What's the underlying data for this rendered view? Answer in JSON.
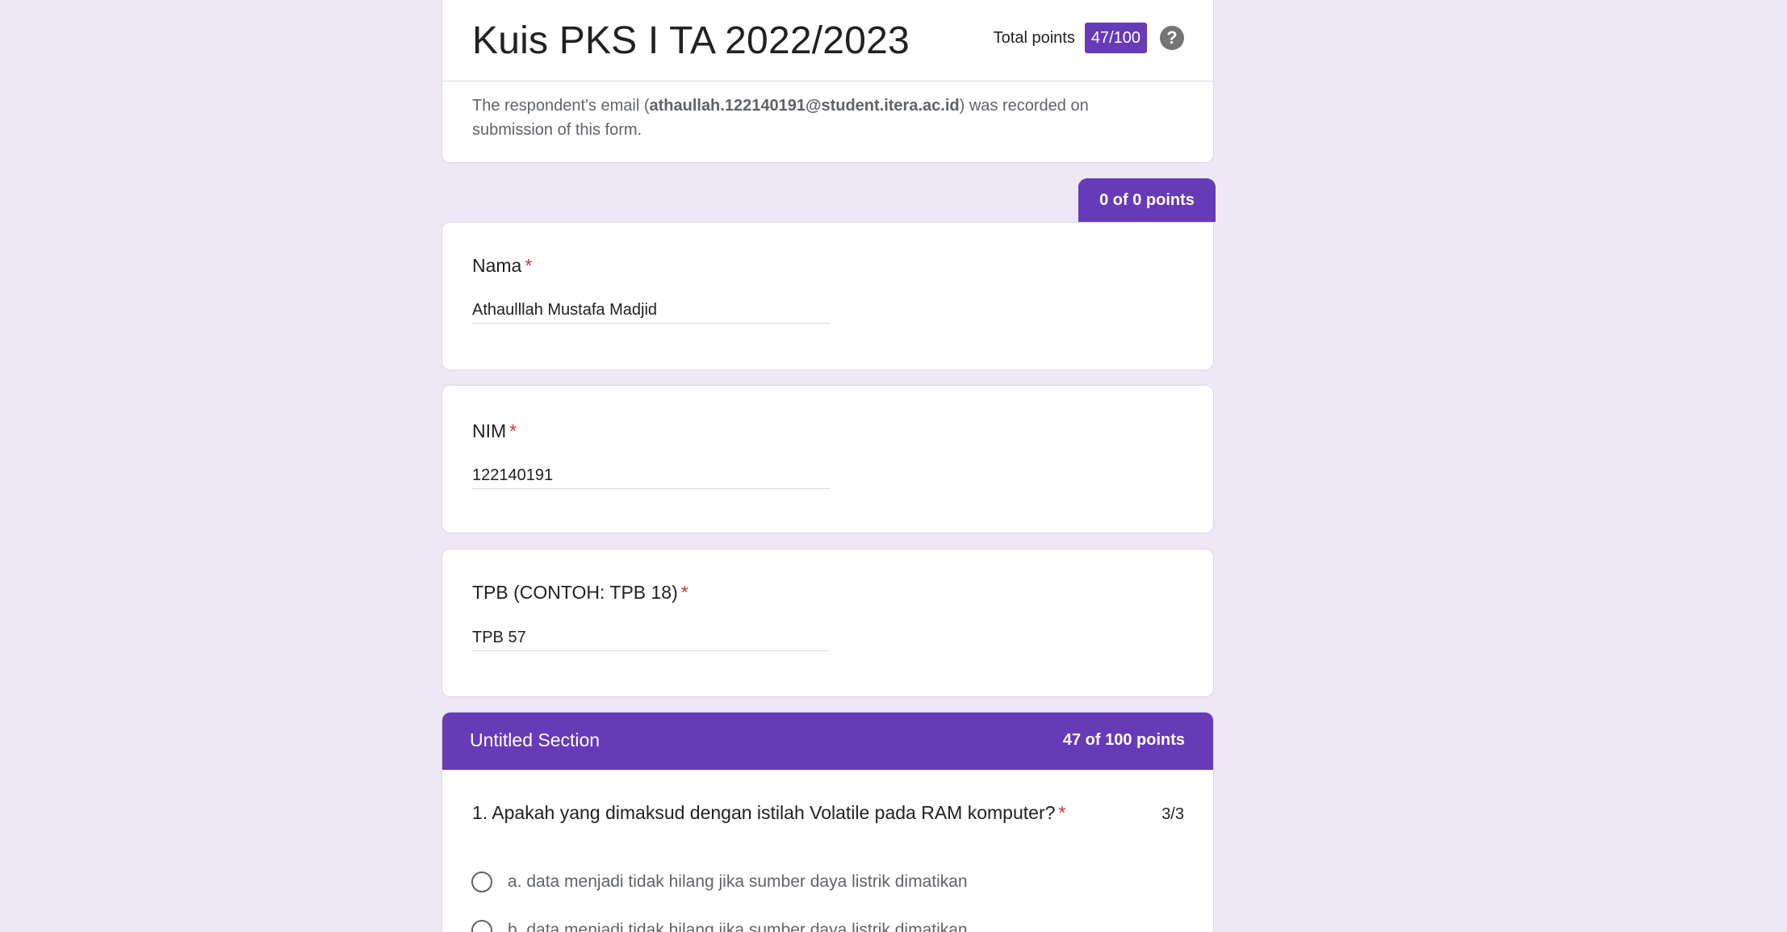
{
  "header": {
    "title": "Kuis PKS I TA 2022/2023",
    "total_points_label": "Total points",
    "score": "47/100",
    "help_icon": "help-icon",
    "email_prefix": "The respondent's email (",
    "email": "athaullah.122140191@student.itera.ac.id",
    "email_suffix": ") was recorded on submission of this form."
  },
  "first_section": {
    "points_tab": "0 of 0 points"
  },
  "questions": [
    {
      "label": "Nama",
      "required_mark": "*",
      "answer": "Athaulllah Mustafa Madjid"
    },
    {
      "label": "NIM",
      "required_mark": "*",
      "answer": "122140191"
    },
    {
      "label": "TPB (CONTOH: TPB 18)",
      "required_mark": "*",
      "answer": "TPB 57"
    }
  ],
  "section": {
    "title": "Untitled Section",
    "points": "47 of 100 points",
    "question": {
      "text": "1. Apakah yang dimaksud dengan istilah Volatile pada RAM komputer?",
      "required_mark": "*",
      "score": "3/3",
      "options": [
        "a. data menjadi tidak hilang jika sumber daya listrik dimatikan",
        "b. data menjadi tidak hilang jika sumber daya listrik dimatikan"
      ]
    }
  }
}
